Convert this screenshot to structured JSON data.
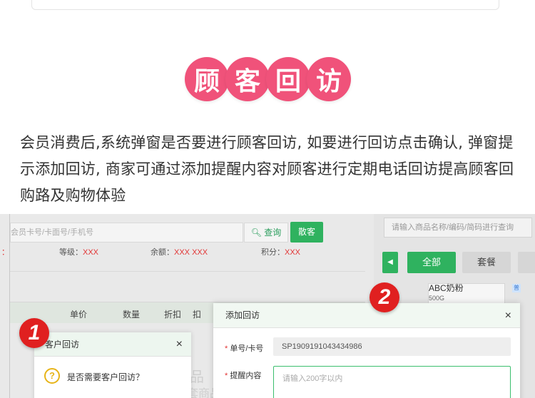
{
  "section": {
    "title_chars": [
      "顾",
      "客",
      "回",
      "访"
    ],
    "description": "会员消费后,系统弹窗是否要进行顾客回访, 如要进行回访点击确认, 弹窗提示添加回访, 商家可通过添加提醒内容对顾客进行定期电话回访提高顾客回购路及购物体验"
  },
  "screenshot": {
    "search_placeholder": "会员卡号/卡面号/手机号",
    "query_label": "查询",
    "scan_label": "散客",
    "info": {
      "level_label": "等级：",
      "level_value": "XXX",
      "balance_label": "余额：",
      "balance_value": "XXX XXX",
      "points_label": "积分：",
      "points_value": "XXX",
      "left_edge": "："
    },
    "table_headers": [
      "单价",
      "数量",
      "折扣",
      "扣"
    ],
    "right_panel": {
      "search_placeholder": "请输入商品名称/编码/简码进行查询",
      "arrow": "◀",
      "all_label": "全部",
      "set_label": "套餐",
      "product_name": "ABC奶粉",
      "product_spec": "500G",
      "tag": "普"
    },
    "badge1": "1",
    "badge2": "2",
    "dialog1": {
      "title": "客户回访",
      "close": "×",
      "icon_text": "?",
      "question": "是否需要客户回访？"
    },
    "ghost": [
      "品",
      "套商品"
    ],
    "dialog2": {
      "title": "添加回访",
      "close": "×",
      "order_label": "单号/卡号",
      "order_value": "SP1909191043434986",
      "remind_label": "提醒内容",
      "remind_placeholder": "请输入200字以内",
      "required_mark": "*"
    }
  },
  "colors": {
    "title_pink": "#f0527a",
    "brand_green": "#2fb25f",
    "badge_red": "#e02020"
  }
}
